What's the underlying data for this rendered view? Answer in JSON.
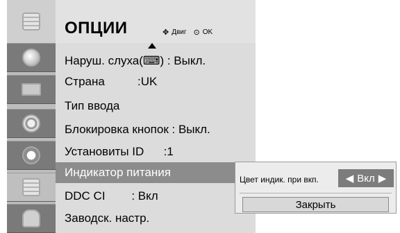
{
  "header": {
    "title": "ОПЦИИ",
    "nav_hint": "Двиг",
    "ok_hint": "OK",
    "nav_symbol": "✥",
    "ok_symbol": "⊙"
  },
  "menu": {
    "items": [
      {
        "label": "Наруш. слуха(⌨) : Выкл."
      },
      {
        "label": "Страна          :UK"
      },
      {
        "label": "Тип ввода"
      },
      {
        "label": "Блокировка кнопок : Выкл."
      },
      {
        "label": "Установиты ID      :1"
      },
      {
        "label": "Индикатор питания"
      },
      {
        "label": "DDC CI        : Вкл"
      },
      {
        "label": "Заводск. настр."
      }
    ],
    "selected_index": 5
  },
  "sidebar": {
    "icons": [
      "picture-icon",
      "display-icon",
      "audio-icon",
      "clock-icon",
      "options-icon",
      "lock-icon"
    ],
    "active_icon": "options-icon"
  },
  "popup": {
    "label": "Цвет индик. при вкп.",
    "value": "Вкл",
    "left_arrow": "◀",
    "right_arrow": "▶",
    "close_label": "Закрыть"
  },
  "colors": {
    "selected_row": "#8c8c8c",
    "sidebar_bg": "#7a7a7a",
    "panel_bg": "#dcdcdc"
  }
}
